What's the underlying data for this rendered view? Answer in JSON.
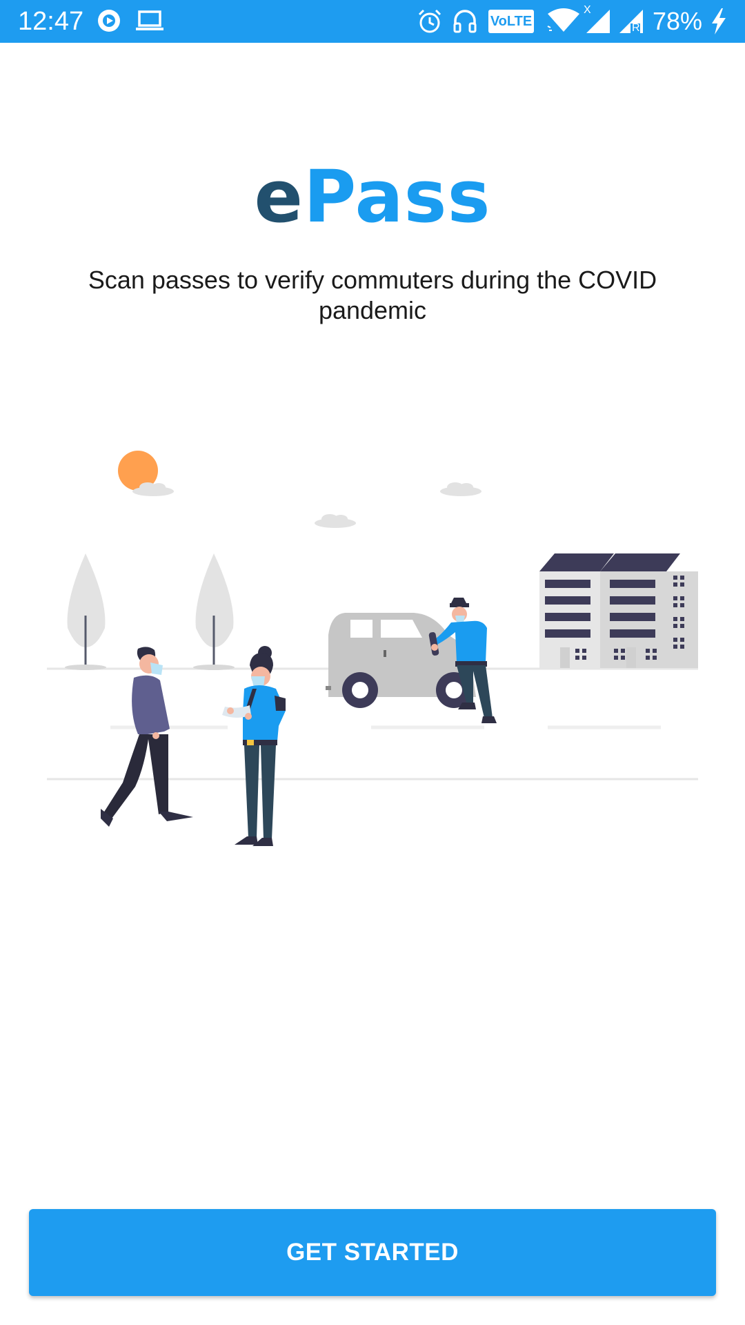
{
  "status_bar": {
    "time": "12:47",
    "battery_percent": "78%",
    "volte_label": "VoLTE",
    "network_x_label": "X",
    "roaming_label": "R",
    "icons": [
      "play-circle-icon",
      "laptop-icon",
      "alarm-icon",
      "headset-icon",
      "volte-icon",
      "wifi-icon",
      "signal-icon",
      "signal-roaming-icon",
      "battery-charging-icon"
    ]
  },
  "logo": {
    "prefix": "e",
    "suffix": "Pass",
    "prefix_color": "#22506e",
    "suffix_color": "#1a9cf0"
  },
  "subtitle": "Scan passes to verify commuters during the COVID pandemic",
  "illustration": {
    "description_icon": "police-checkpoint-illustration"
  },
  "cta": {
    "label": "GET STARTED",
    "color": "#1e9cf0"
  },
  "colors": {
    "status_bar": "#1e9cf0",
    "background": "#ffffff"
  }
}
